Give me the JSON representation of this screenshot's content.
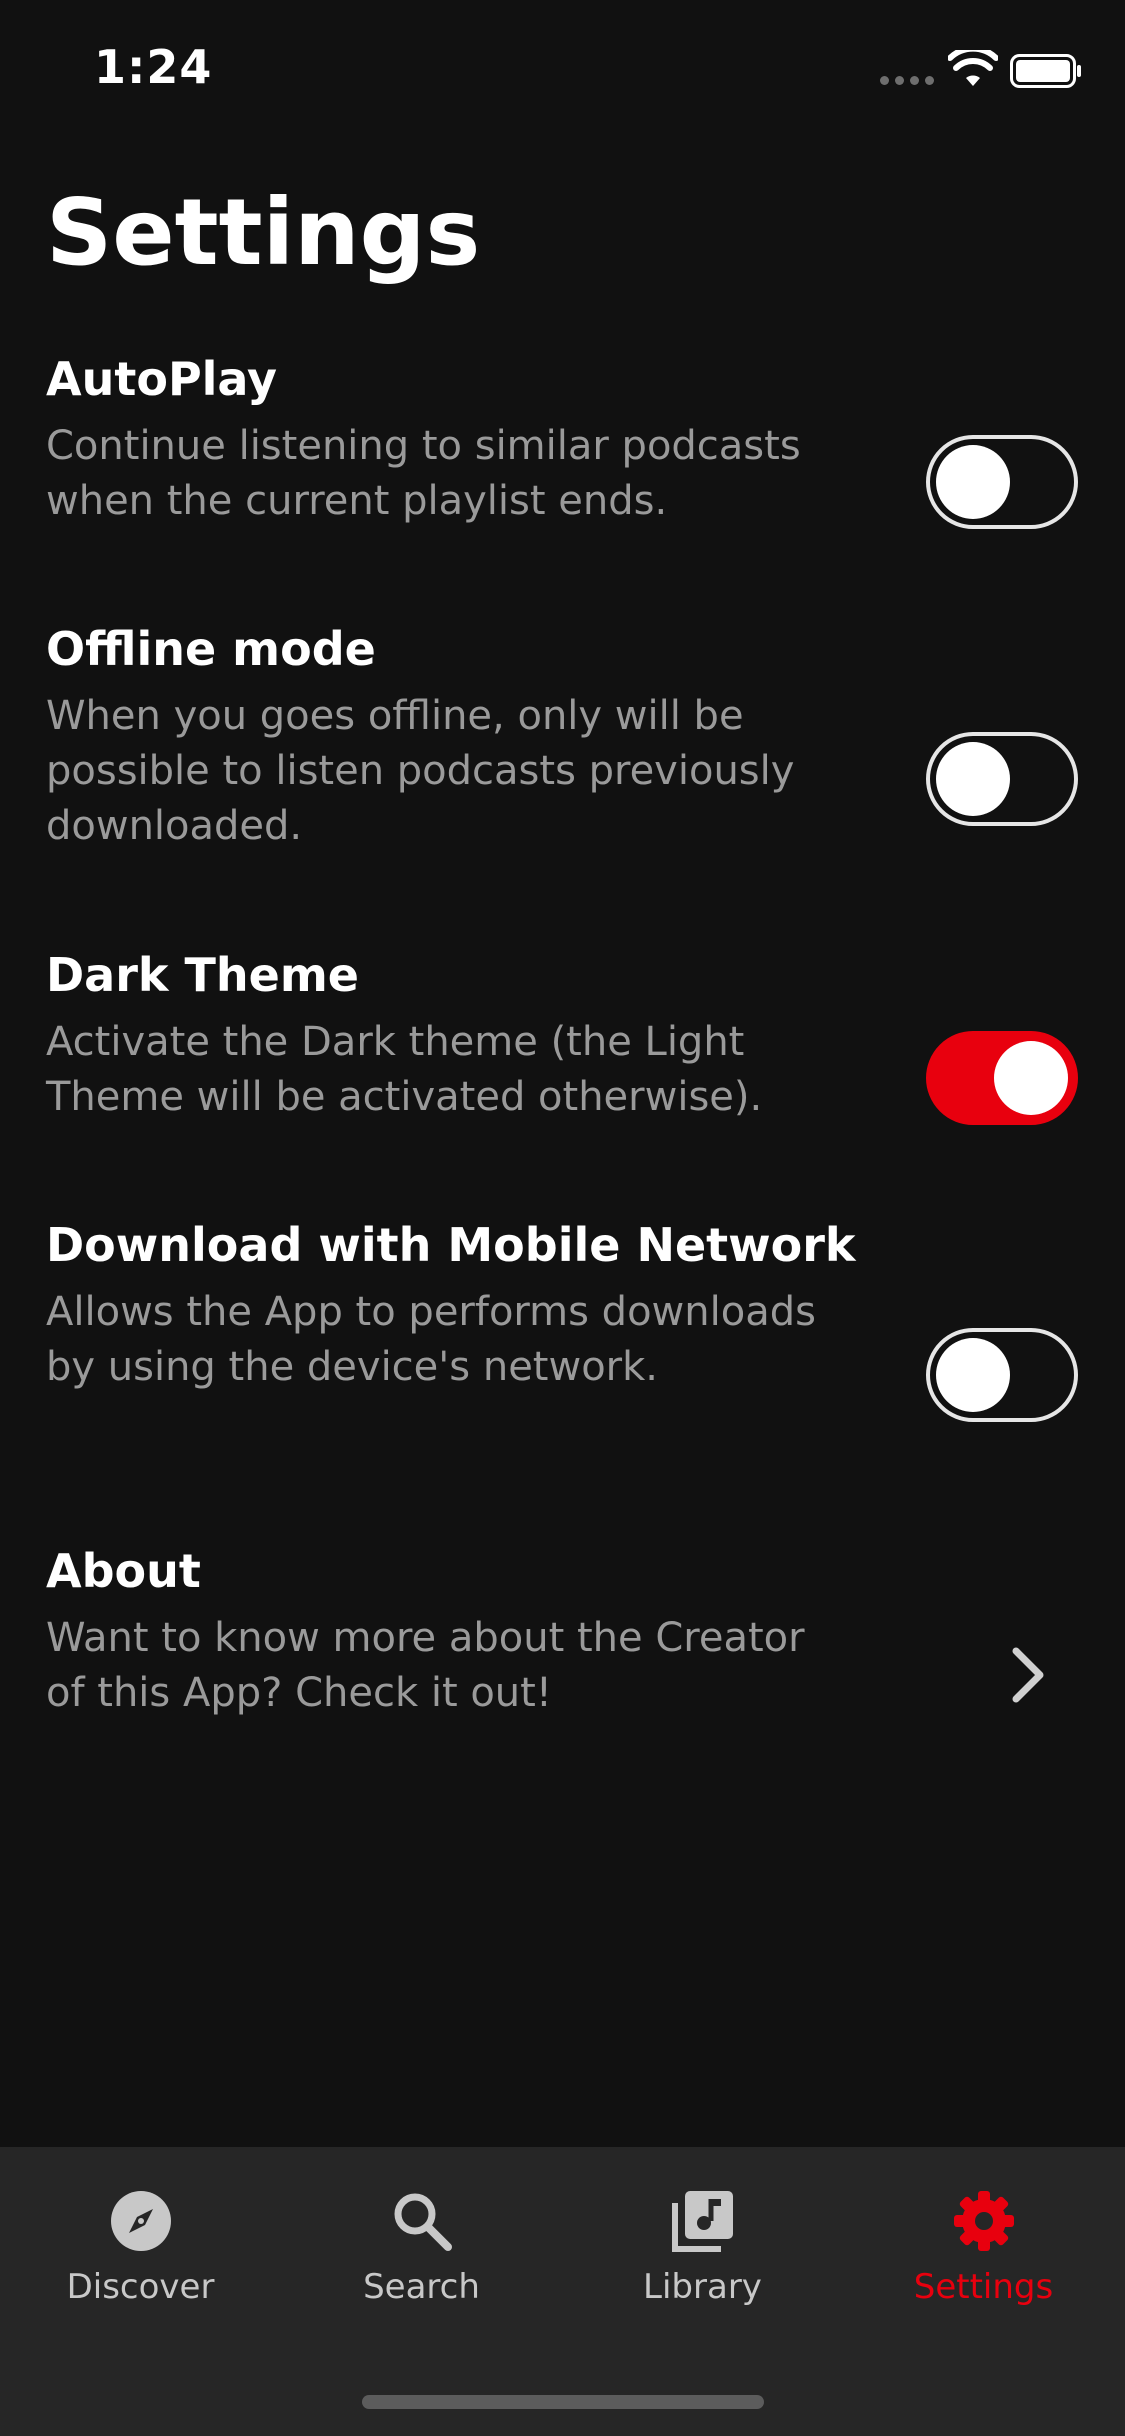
{
  "status_bar": {
    "time": "1:24"
  },
  "page": {
    "title": "Settings"
  },
  "settings": [
    {
      "title": "AutoPlay",
      "description": "Continue listening to similar podcasts when the current playlist ends.",
      "control": "toggle",
      "enabled": false
    },
    {
      "title": "Offline mode",
      "description": "When you goes offline, only will be possible to listen podcasts previously downloaded.",
      "control": "toggle",
      "enabled": false
    },
    {
      "title": "Dark Theme",
      "description": "Activate the Dark theme (the Light Theme will be activated otherwise).",
      "control": "toggle",
      "enabled": true
    },
    {
      "title": "Download with Mobile Network",
      "description": "Allows the App to performs downloads by using the device's network.",
      "control": "toggle",
      "enabled": false
    },
    {
      "title": "About",
      "description": "Want to know more about the Creator of this App? Check it out!",
      "control": "chevron-right-icon"
    }
  ],
  "tab_bar": {
    "tabs": [
      {
        "label": "Discover",
        "icon": "compass-icon",
        "active": false
      },
      {
        "label": "Search",
        "icon": "search-icon",
        "active": false
      },
      {
        "label": "Library",
        "icon": "library-music-icon",
        "active": false
      },
      {
        "label": "Settings",
        "icon": "gear-icon",
        "active": true
      }
    ]
  },
  "colors": {
    "background": "#111111",
    "tab_bar_background": "#262626",
    "accent": "#e8000e",
    "secondary_text": "#9a9a9a",
    "inactive_tab": "#c8c8c8"
  }
}
